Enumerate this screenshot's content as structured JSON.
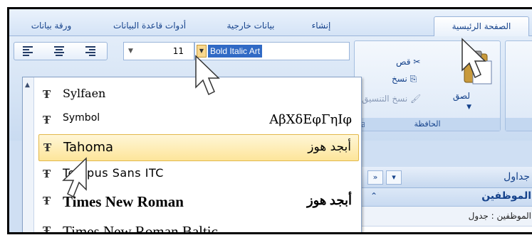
{
  "ribbon_tabs": [
    {
      "label": "ورقة بيانات"
    },
    {
      "label": "أدوات قاعدة البيانات"
    },
    {
      "label": "بيانات خارجية"
    },
    {
      "label": "إنشاء"
    },
    {
      "label": "الصفحة الرئيسية",
      "active": true
    }
  ],
  "font_toolbar": {
    "font_name": "Bold Italic Art",
    "font_size": "11",
    "align_buttons": [
      "align-left",
      "align-center",
      "align-right"
    ]
  },
  "clipboard_group": {
    "label": "الحافظة",
    "cut_label": "قص",
    "copy_label": "نسخ",
    "paste_label": "لصق",
    "format_painter_label": "نسخ التنسيق"
  },
  "font_list": [
    {
      "name": "Sylfaen",
      "sample": ""
    },
    {
      "name": "Symbol",
      "sample": "ΑβΧδΕφΓηΙφ"
    },
    {
      "name": "Tahoma",
      "sample": "أبجد هوز",
      "highlighted": true
    },
    {
      "name": "Tempus Sans ITC",
      "sample": ""
    },
    {
      "name": "Times New Roman",
      "sample": "أبجد هوز"
    },
    {
      "name": "Times New Roman Baltic",
      "sample": ""
    }
  ],
  "nav_pane": {
    "header_title": "جداول",
    "group_title": "الموظفين",
    "item_text": "الموظفين : جدول"
  }
}
